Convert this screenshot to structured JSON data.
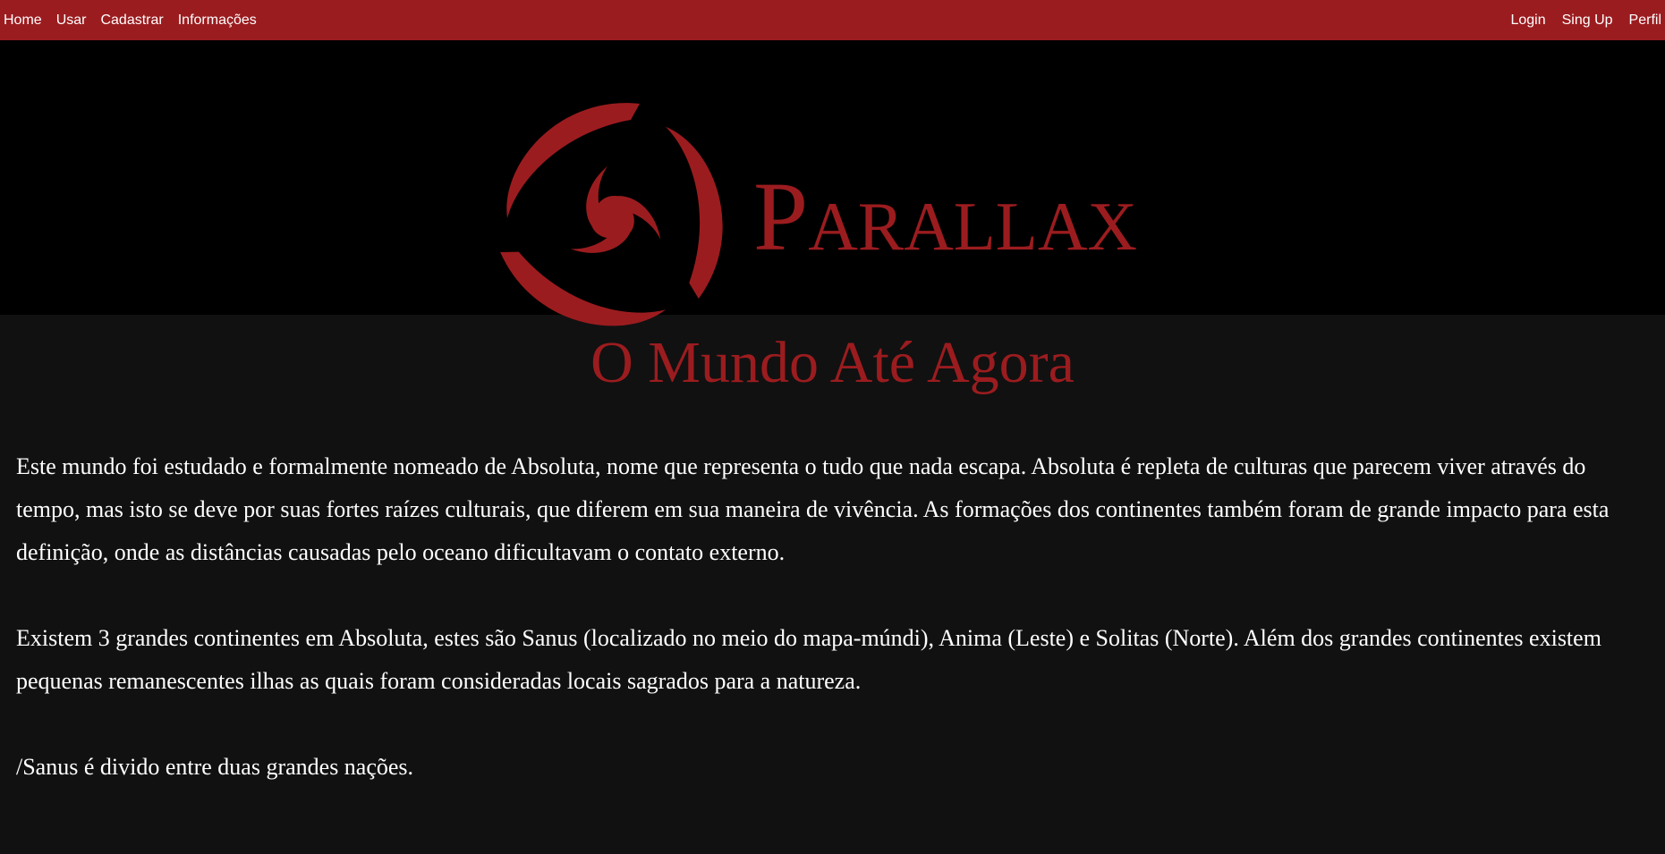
{
  "colors": {
    "brand": "#9b1c1f",
    "banner_bg": "#000000",
    "content_bg": "#111111",
    "text": "#ffffff"
  },
  "nav": {
    "left": [
      {
        "label": "Home"
      },
      {
        "label": "Usar"
      },
      {
        "label": "Cadastrar"
      },
      {
        "label": "Informações"
      }
    ],
    "right": [
      {
        "label": "Login"
      },
      {
        "label": "Sing Up"
      },
      {
        "label": "Perfil"
      }
    ]
  },
  "banner": {
    "logo_icon": "triquetra-icon",
    "logo_first_letter": "P",
    "logo_rest": "ARALLAX"
  },
  "main": {
    "title": "O Mundo Até Agora",
    "paragraphs": [
      "Este mundo foi estudado e formalmente nomeado de Absoluta, nome que representa o tudo que nada escapa. Absoluta é repleta de culturas que parecem viver através do tempo, mas isto se deve por suas fortes raízes culturais, que diferem em sua maneira de vivência. As formações dos continentes também foram de grande impacto para esta definição, onde as distâncias causadas pelo oceano dificultavam o contato externo.",
      "Existem 3 grandes continentes em Absoluta, estes são Sanus (localizado no meio do mapa-múndi), Anima (Leste) e Solitas (Norte). Além dos grandes continentes existem pequenas remanescentes ilhas as quais foram consideradas locais sagrados para a natureza.",
      "/Sanus é divido entre duas grandes nações."
    ]
  }
}
